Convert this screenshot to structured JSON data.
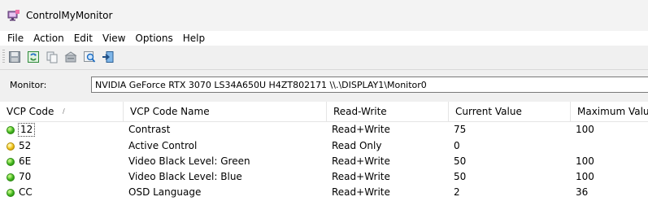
{
  "window": {
    "title": "ControlMyMonitor"
  },
  "menu": [
    "File",
    "Action",
    "Edit",
    "View",
    "Options",
    "Help"
  ],
  "toolbar": {
    "buttons": [
      "save-icon",
      "refresh-icon",
      "copy-icon",
      "properties-icon",
      "find-icon",
      "exit-icon"
    ]
  },
  "monitor": {
    "label": "Monitor:",
    "value": "NVIDIA GeForce RTX 3070  LS34A650U  H4ZT802171  \\\\.\\DISPLAY1\\Monitor0"
  },
  "table": {
    "columns": [
      "VCP Code",
      "VCP Code Name",
      "Read-Write",
      "Current Value",
      "Maximum Value"
    ],
    "rows": [
      {
        "status": "green",
        "code": "12",
        "name": "Contrast",
        "rw": "Read+Write",
        "current": "75",
        "max": "100"
      },
      {
        "status": "yellow",
        "code": "52",
        "name": "Active Control",
        "rw": "Read Only",
        "current": "0",
        "max": ""
      },
      {
        "status": "green",
        "code": "6E",
        "name": "Video Black Level: Green",
        "rw": "Read+Write",
        "current": "50",
        "max": "100"
      },
      {
        "status": "green",
        "code": "70",
        "name": "Video Black Level: Blue",
        "rw": "Read+Write",
        "current": "50",
        "max": "100"
      },
      {
        "status": "green",
        "code": "CC",
        "name": "OSD Language",
        "rw": "Read+Write",
        "current": "2",
        "max": "36"
      }
    ]
  },
  "colors": {
    "status_green": "#41b51f",
    "status_yellow": "#f1c21b"
  }
}
